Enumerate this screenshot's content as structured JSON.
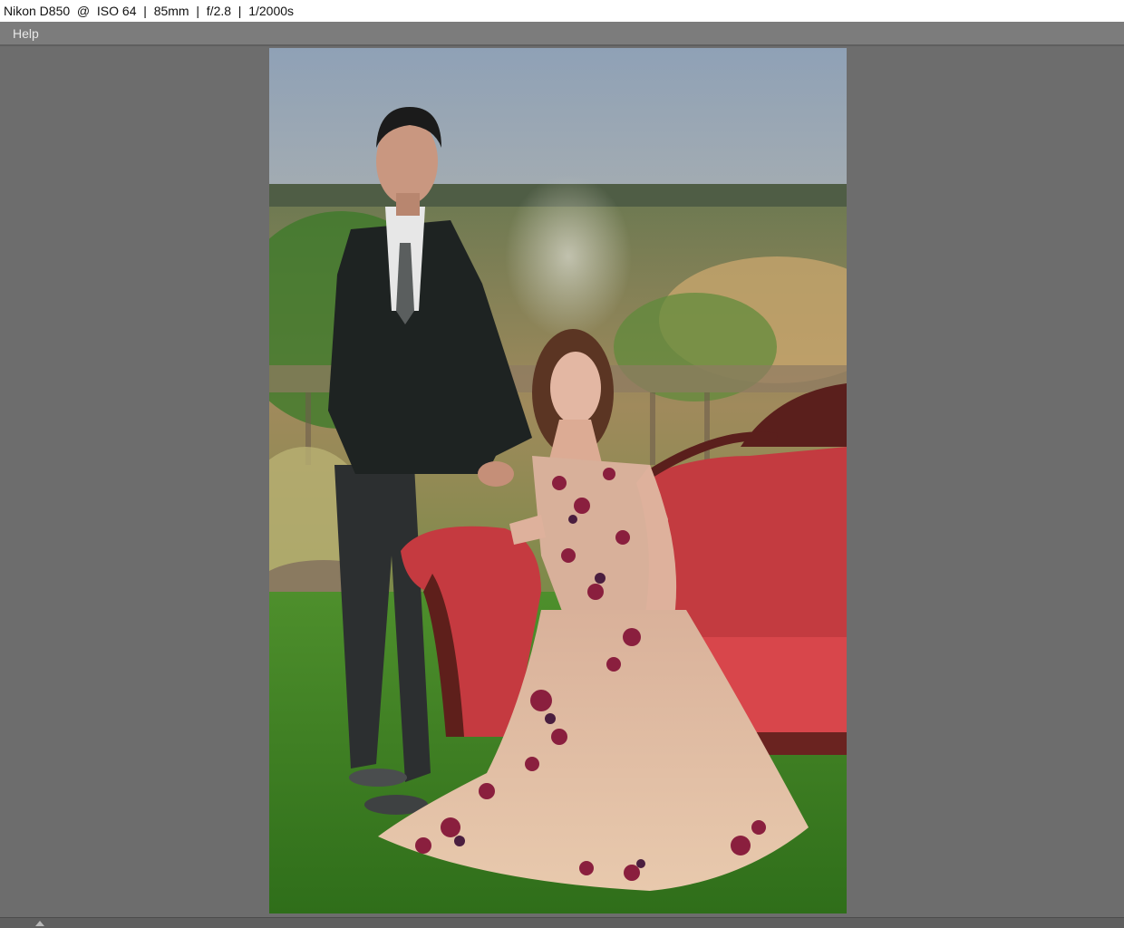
{
  "window": {
    "title": "Nikon D850  @  ISO 64  |  85mm  |  f/2.8  |  1/2000s"
  },
  "menu": {
    "items": [
      {
        "label": "Help"
      }
    ]
  },
  "viewer": {
    "image_description_icon": "photo-preview"
  },
  "bottom_panel": {
    "toggle_icon": "chevron-up-icon"
  }
}
